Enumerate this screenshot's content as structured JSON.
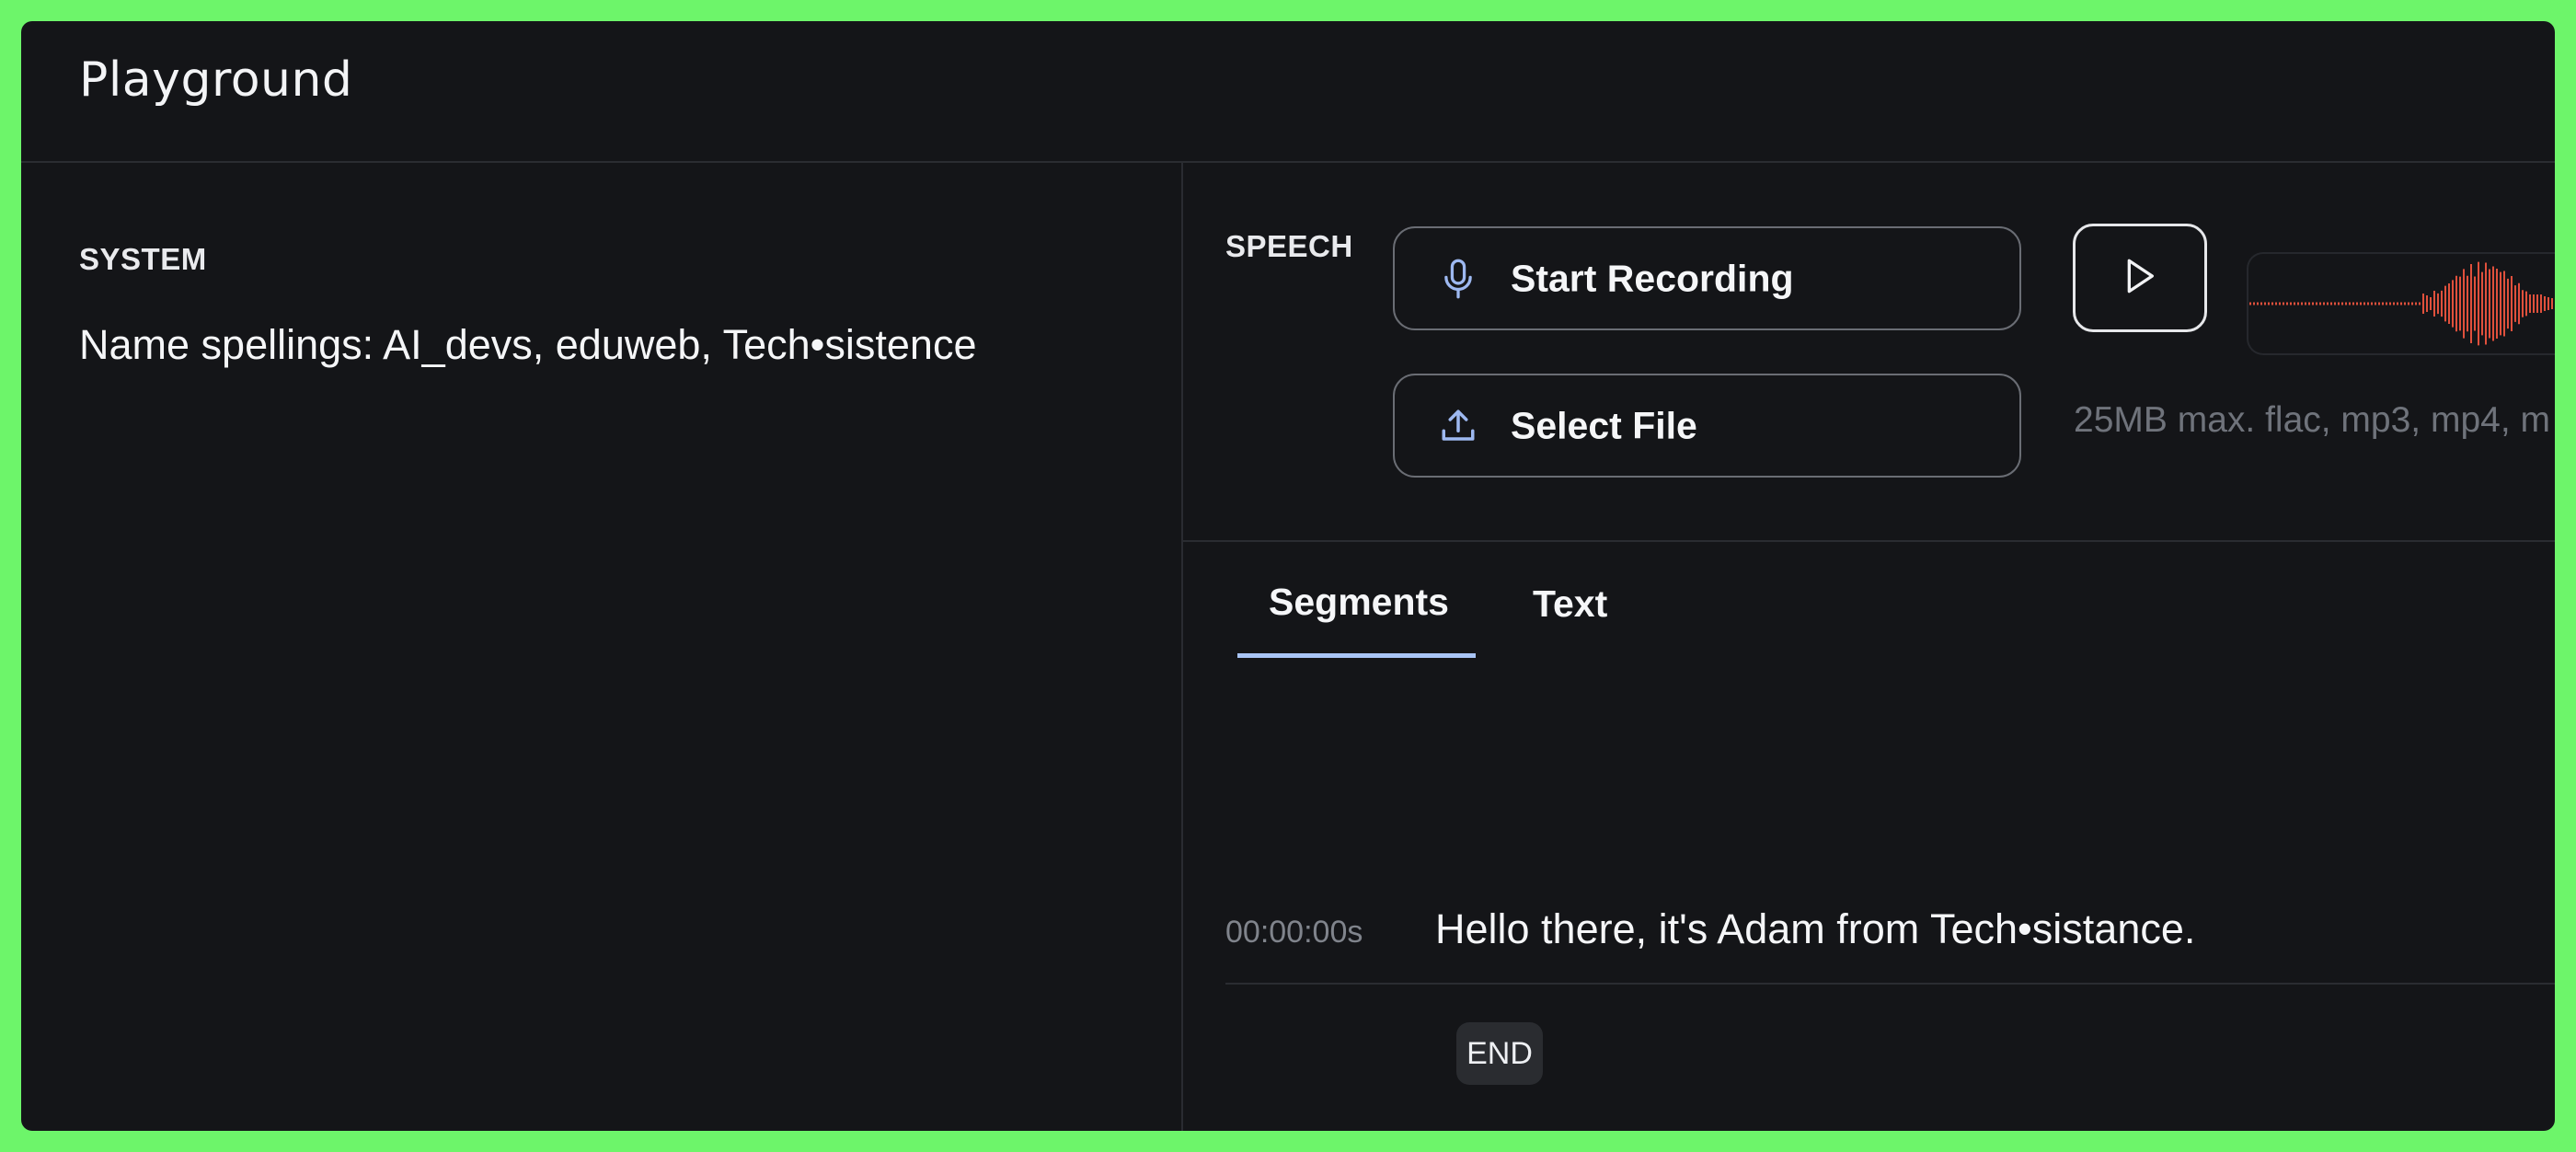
{
  "header": {
    "title": "Playground"
  },
  "system": {
    "label": "SYSTEM",
    "text": "Name spellings: AI_devs, eduweb, Tech•sistence"
  },
  "speech": {
    "label": "SPEECH",
    "record_label": "Start Recording",
    "record_icon": "microphone-icon",
    "play_icon": "play-icon",
    "file_label": "Select File",
    "file_icon": "upload-icon",
    "file_hint": "25MB max. flac, mp3, mp4, m",
    "waveform_color": "#e0503c"
  },
  "tabs": [
    {
      "label": "Segments",
      "active": true
    },
    {
      "label": "Text",
      "active": false
    }
  ],
  "segments": [
    {
      "time": "00:00:00s",
      "text": "Hello there, it's Adam from Tech•sistance."
    }
  ],
  "end_label": "END",
  "colors": {
    "background": "#141518",
    "accent_tab": "#a9c4f5",
    "icon_blue": "#9db8f0",
    "page_border": "#6df56a"
  }
}
